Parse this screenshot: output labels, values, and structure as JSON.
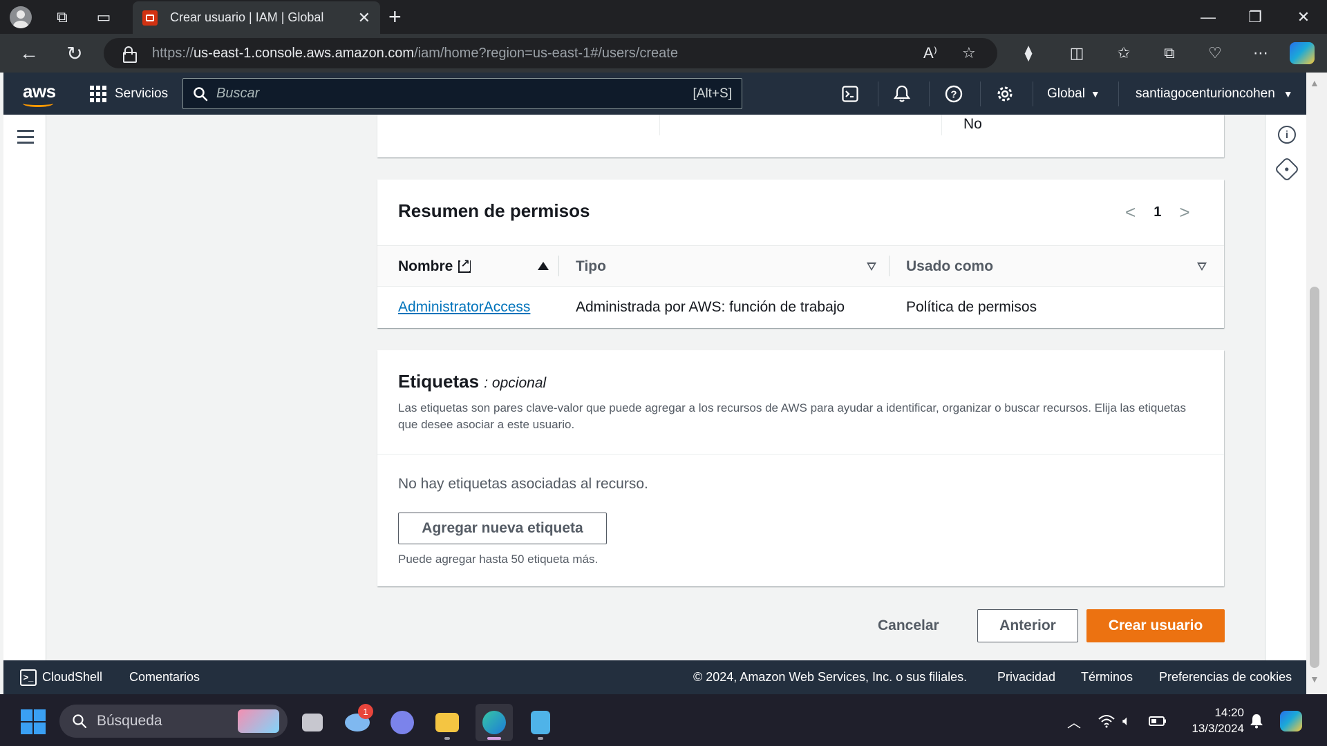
{
  "browser": {
    "tab_title": "Crear usuario | IAM | Global",
    "url_prefix": "https://",
    "url_host": "us-east-1.console.aws.amazon.com",
    "url_path": "/iam/home?region=us-east-1#/users/create"
  },
  "aws_nav": {
    "logo": "aws",
    "services_label": "Servicios",
    "search_placeholder": "Buscar",
    "search_shortcut": "[Alt+S]",
    "region_label": "Global",
    "account_label": "santiagocenturioncohen"
  },
  "previous_section": {
    "value": "No"
  },
  "permissions_summary": {
    "title": "Resumen de permisos",
    "page": "1",
    "columns": [
      "Nombre",
      "Tipo",
      "Usado como"
    ],
    "rows": [
      {
        "name": "AdministratorAccess",
        "type": "Administrada por AWS: función de trabajo",
        "used_as": "Política de permisos"
      }
    ]
  },
  "tags": {
    "title": "Etiquetas",
    "optional": ": opcional",
    "description": "Las etiquetas son pares clave-valor que puede agregar a los recursos de AWS para ayudar a identificar, organizar o buscar recursos. Elija las etiquetas que desee asociar a este usuario.",
    "empty_text": "No hay etiquetas asociadas al recurso.",
    "add_button": "Agregar nueva etiqueta",
    "limit_note": "Puede agregar hasta 50 etiqueta más."
  },
  "actions": {
    "cancel": "Cancelar",
    "previous": "Anterior",
    "create": "Crear usuario"
  },
  "footer": {
    "cloudshell": "CloudShell",
    "feedback": "Comentarios",
    "copyright": "© 2024, Amazon Web Services, Inc. o sus filiales.",
    "privacy": "Privacidad",
    "terms": "Términos",
    "cookies": "Preferencias de cookies"
  },
  "taskbar": {
    "search_placeholder": "Búsqueda",
    "notification_count": "1",
    "time": "14:20",
    "date": "13/3/2024"
  },
  "colors": {
    "aws_nav_bg": "#232f3e",
    "primary_button": "#ec7211",
    "link": "#0073bb"
  }
}
